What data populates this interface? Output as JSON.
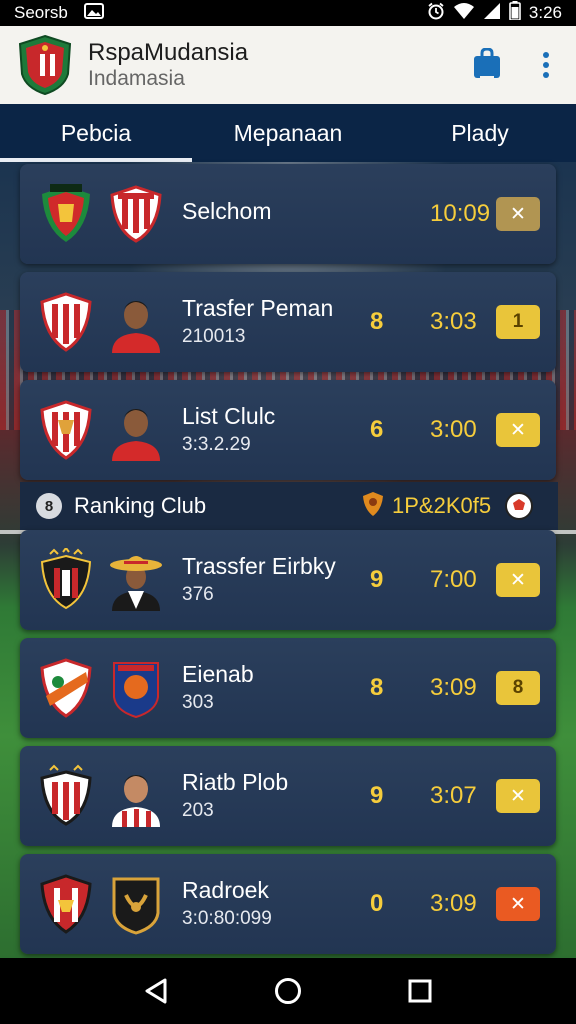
{
  "status_bar": {
    "carrier": "Seorsb",
    "time": "3:26",
    "icons": [
      "image-icon",
      "alarm-icon",
      "wifi-icon",
      "signal-icon",
      "battery-icon"
    ]
  },
  "header": {
    "title": "RspaMudansia",
    "subtitle": "Indamasia",
    "logo": "club-crest-logo",
    "actions": [
      "bag-icon",
      "more-vert-icon"
    ]
  },
  "tabs": [
    {
      "label": "Pebcia",
      "active": true
    },
    {
      "label": "Mepanaan",
      "active": false
    },
    {
      "label": "Plady",
      "active": false
    }
  ],
  "rows": [
    {
      "name": "Selchom",
      "sub": "",
      "score": "",
      "time": "10:09",
      "badge": "✕",
      "badge_color": "#b19552",
      "crest_a": "red-green-crest",
      "crest_b": "red-white-crest"
    },
    {
      "name": "Trasfer Peman",
      "sub": "210013",
      "score": "8",
      "time": "3:03",
      "badge": "1",
      "badge_color": "#e9c53a",
      "crest_a": "red-white-striped-crest",
      "crest_b": "player-avatar"
    },
    {
      "name": "List Clulc",
      "sub": "3:3.2.29",
      "score": "6",
      "time": "3:00",
      "badge": "✕",
      "badge_color": "#e9c53a",
      "crest_a": "red-white-striped-crest",
      "crest_b": "player-avatar"
    }
  ],
  "section": {
    "label": "Ranking Club",
    "icon_text": "8",
    "rank_value": "1P&2K0f5",
    "icons": [
      "badge-icon",
      "soccer-ball-icon"
    ]
  },
  "rows2": [
    {
      "name": "Trassfer Eirbky",
      "sub": "376",
      "score": "9",
      "time": "7:00",
      "badge": "✕",
      "badge_color": "#e9c53a",
      "crest_a": "black-red-crest",
      "crest_b": "sombrero-player-avatar"
    },
    {
      "name": "Eienab",
      "sub": "303",
      "score": "8",
      "time": "3:09",
      "badge": "8",
      "badge_color": "#e9c53a",
      "crest_a": "orange-white-crest",
      "crest_b": "navy-orange-crest"
    },
    {
      "name": "Riatb Plob",
      "sub": "203",
      "score": "9",
      "time": "3:07",
      "badge": "✕",
      "badge_color": "#e9c53a",
      "crest_a": "red-white-striped-crest",
      "crest_b": "player-avatar"
    },
    {
      "name": "Radroek",
      "sub": "3:0:80:099",
      "score": "0",
      "time": "3:09",
      "badge": "✕",
      "badge_color": "#ea5a22",
      "crest_a": "red-black-crest",
      "crest_b": "gold-black-crest"
    }
  ],
  "nav": [
    "back-icon",
    "home-icon",
    "recents-icon"
  ]
}
